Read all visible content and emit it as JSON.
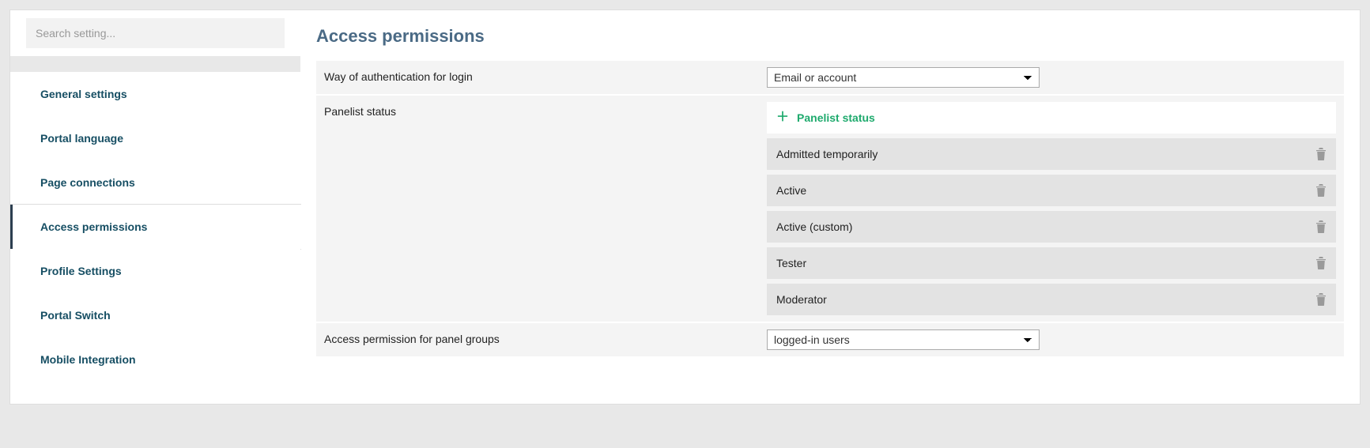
{
  "sidebar": {
    "search_placeholder": "Search setting...",
    "items": [
      {
        "label": "General settings",
        "name": "sidebar-item-general-settings"
      },
      {
        "label": "Portal language",
        "name": "sidebar-item-portal-language"
      },
      {
        "label": "Page connections",
        "name": "sidebar-item-page-connections"
      },
      {
        "label": "Access permissions",
        "name": "sidebar-item-access-permissions",
        "active": true
      },
      {
        "label": "Profile Settings",
        "name": "sidebar-item-profile-settings"
      },
      {
        "label": "Portal Switch",
        "name": "sidebar-item-portal-switch"
      },
      {
        "label": "Mobile Integration",
        "name": "sidebar-item-mobile-integration"
      }
    ]
  },
  "main": {
    "title": "Access permissions",
    "auth_row": {
      "label": "Way of authentication for login",
      "selected": "Email or account"
    },
    "panelist_row": {
      "label": "Panelist status",
      "add_label": "Panelist status",
      "items": [
        "Admitted temporarily",
        "Active",
        "Active (custom)",
        "Tester",
        "Moderator"
      ]
    },
    "panel_groups_row": {
      "label": "Access permission for panel groups",
      "selected": "logged-in users"
    }
  }
}
